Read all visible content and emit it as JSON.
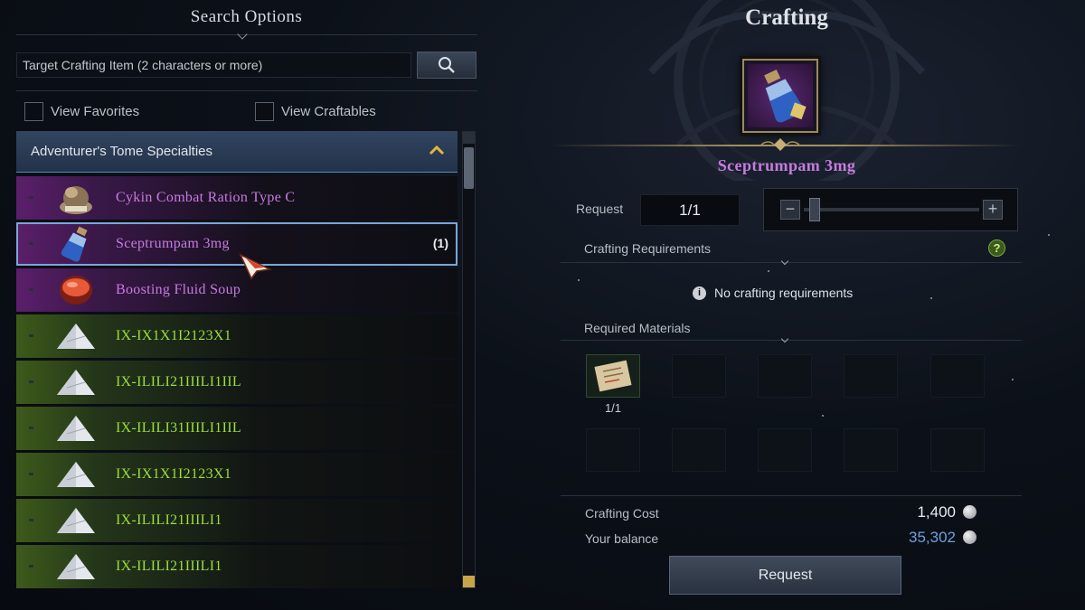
{
  "search": {
    "title": "Search Options",
    "placeholder": "Target Crafting Item (2 characters or more)"
  },
  "filters": {
    "favorites_label": "View Favorites",
    "craftables_label": "View Craftables"
  },
  "category": {
    "label": "Adventurer's Tome Specialties"
  },
  "items": [
    {
      "name": "Cykin Combat Ration Type C",
      "grade": "epic",
      "icon": "ration-sack-icon",
      "count": ""
    },
    {
      "name": "Sceptrumpam 3mg",
      "grade": "epic",
      "icon": "potion-bottle-icon",
      "count": "(1)",
      "selected": true
    },
    {
      "name": "Boosting Fluid Soup",
      "grade": "epic",
      "icon": "soup-bowl-icon",
      "count": ""
    },
    {
      "name": "IX-IX1X1I2123X1",
      "grade": "uncommon",
      "icon": "powder-pile-icon",
      "count": ""
    },
    {
      "name": "IX-ILILI21IIILI1IIL",
      "grade": "uncommon",
      "icon": "powder-pile-icon",
      "count": ""
    },
    {
      "name": "IX-ILILI31IIILI1IIL",
      "grade": "uncommon",
      "icon": "powder-pile-icon",
      "count": ""
    },
    {
      "name": "IX-IX1X1I2123X1",
      "grade": "uncommon",
      "icon": "powder-pile-icon",
      "count": ""
    },
    {
      "name": "IX-ILILI21IIILI1",
      "grade": "uncommon",
      "icon": "powder-pile-icon",
      "count": ""
    },
    {
      "name": "IX-ILILI21IIILI1",
      "grade": "uncommon",
      "icon": "powder-pile-icon",
      "count": ""
    }
  ],
  "crafting": {
    "title": "Crafting",
    "item_name": "Sceptrumpam 3mg",
    "request_label": "Request",
    "request_qty": "1/1",
    "slider_fraction": 0.0,
    "requirements_label": "Crafting Requirements",
    "no_requirements": "No crafting requirements",
    "materials_label": "Required Materials",
    "material_count": "1/1",
    "cost_label": "Crafting Cost",
    "cost_value": "1,400",
    "balance_label": "Your balance",
    "balance_value": "35,302",
    "request_button": "Request"
  },
  "colors": {
    "epic_name": "#c77be0",
    "uncommon_name": "#9dde3e",
    "balance": "#6f9fe0",
    "selection_outline": "#7aa6d8"
  }
}
